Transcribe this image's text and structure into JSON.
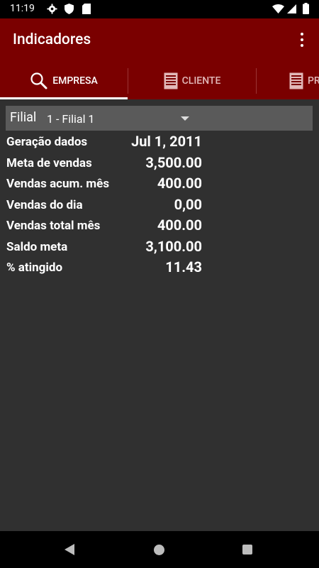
{
  "status": {
    "time": "11:19",
    "left_icons": [
      "gear-icon",
      "shield-icon",
      "sd-card-icon"
    ],
    "right_icons": [
      "wifi-icon",
      "signal-icon",
      "battery-icon"
    ]
  },
  "appbar": {
    "title": "Indicadores"
  },
  "tabs": [
    {
      "label": "EMPRESA",
      "icon": "search-icon",
      "active": true
    },
    {
      "label": "CLIENTE",
      "icon": "document-icon",
      "active": false
    },
    {
      "label": "PR",
      "icon": "document-icon",
      "active": false
    }
  ],
  "filial": {
    "label": "Filial",
    "selected": "1 - Filial 1"
  },
  "indicators": [
    {
      "label": "Geração dados",
      "value": "Jul 1, 2011"
    },
    {
      "label": "Meta de vendas",
      "value": "3,500.00"
    },
    {
      "label": "Vendas acum. mês",
      "value": "400.00"
    },
    {
      "label": "Vendas do dia",
      "value": "0,00"
    },
    {
      "label": "Vendas total mês",
      "value": "400.00"
    },
    {
      "label": "Saldo meta",
      "value": "3,100.00"
    },
    {
      "label": "% atingido",
      "value": "11.43"
    }
  ],
  "colors": {
    "appbar": "#7a0000",
    "background": "#303030",
    "spinner": "#5a5a5a"
  }
}
